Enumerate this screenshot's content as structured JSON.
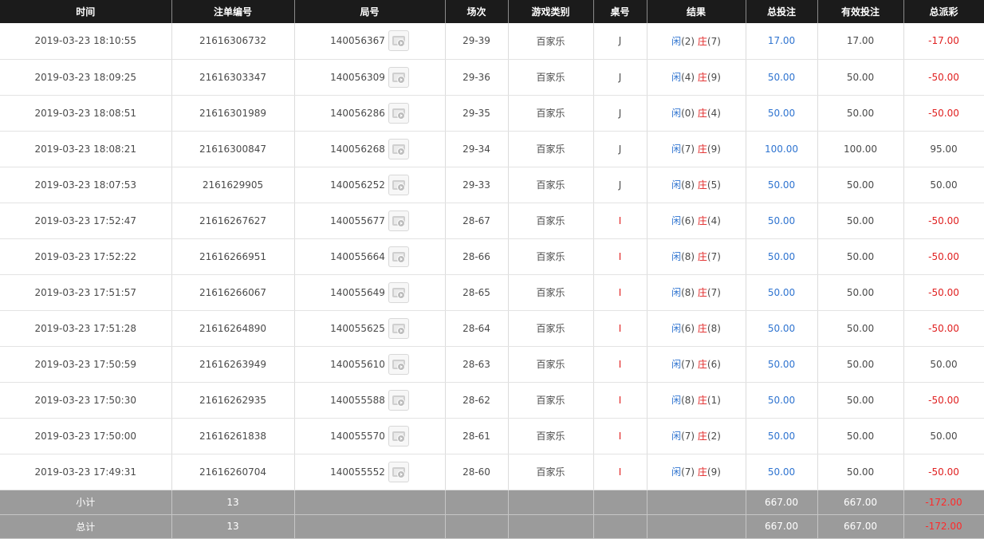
{
  "headers": [
    "时间",
    "注单编号",
    "局号",
    "场次",
    "游戏类别",
    "桌号",
    "结果",
    "总投注",
    "有效投注",
    "总派彩"
  ],
  "result_labels": {
    "player": "闲",
    "banker": "庄"
  },
  "rows": [
    {
      "time": "2019-03-23 18:10:55",
      "bet_id": "21616306732",
      "round": "140056367",
      "session": "29-39",
      "game": "百家乐",
      "table": "J",
      "p": "(2)",
      "b": "(7)",
      "total": "17.00",
      "valid": "17.00",
      "payout": "-17.00",
      "neg": true
    },
    {
      "time": "2019-03-23 18:09:25",
      "bet_id": "21616303347",
      "round": "140056309",
      "session": "29-36",
      "game": "百家乐",
      "table": "J",
      "p": "(4)",
      "b": "(9)",
      "total": "50.00",
      "valid": "50.00",
      "payout": "-50.00",
      "neg": true
    },
    {
      "time": "2019-03-23 18:08:51",
      "bet_id": "21616301989",
      "round": "140056286",
      "session": "29-35",
      "game": "百家乐",
      "table": "J",
      "p": "(0)",
      "b": "(4)",
      "total": "50.00",
      "valid": "50.00",
      "payout": "-50.00",
      "neg": true
    },
    {
      "time": "2019-03-23 18:08:21",
      "bet_id": "21616300847",
      "round": "140056268",
      "session": "29-34",
      "game": "百家乐",
      "table": "J",
      "p": "(7)",
      "b": "(9)",
      "total": "100.00",
      "valid": "100.00",
      "payout": "95.00",
      "neg": false
    },
    {
      "time": "2019-03-23 18:07:53",
      "bet_id": "2161629905",
      "round": "140056252",
      "session": "29-33",
      "game": "百家乐",
      "table": "J",
      "p": "(8)",
      "b": "(5)",
      "total": "50.00",
      "valid": "50.00",
      "payout": "50.00",
      "neg": false
    },
    {
      "time": "2019-03-23 17:52:47",
      "bet_id": "21616267627",
      "round": "140055677",
      "session": "28-67",
      "game": "百家乐",
      "table": "I",
      "p": "(6)",
      "b": "(4)",
      "total": "50.00",
      "valid": "50.00",
      "payout": "-50.00",
      "neg": true
    },
    {
      "time": "2019-03-23 17:52:22",
      "bet_id": "21616266951",
      "round": "140055664",
      "session": "28-66",
      "game": "百家乐",
      "table": "I",
      "p": "(8)",
      "b": "(7)",
      "total": "50.00",
      "valid": "50.00",
      "payout": "-50.00",
      "neg": true
    },
    {
      "time": "2019-03-23 17:51:57",
      "bet_id": "21616266067",
      "round": "140055649",
      "session": "28-65",
      "game": "百家乐",
      "table": "I",
      "p": "(8)",
      "b": "(7)",
      "total": "50.00",
      "valid": "50.00",
      "payout": "-50.00",
      "neg": true
    },
    {
      "time": "2019-03-23 17:51:28",
      "bet_id": "21616264890",
      "round": "140055625",
      "session": "28-64",
      "game": "百家乐",
      "table": "I",
      "p": "(6)",
      "b": "(8)",
      "total": "50.00",
      "valid": "50.00",
      "payout": "-50.00",
      "neg": true
    },
    {
      "time": "2019-03-23 17:50:59",
      "bet_id": "21616263949",
      "round": "140055610",
      "session": "28-63",
      "game": "百家乐",
      "table": "I",
      "p": "(7)",
      "b": "(6)",
      "total": "50.00",
      "valid": "50.00",
      "payout": "50.00",
      "neg": false
    },
    {
      "time": "2019-03-23 17:50:30",
      "bet_id": "21616262935",
      "round": "140055588",
      "session": "28-62",
      "game": "百家乐",
      "table": "I",
      "p": "(8)",
      "b": "(1)",
      "total": "50.00",
      "valid": "50.00",
      "payout": "-50.00",
      "neg": true
    },
    {
      "time": "2019-03-23 17:50:00",
      "bet_id": "21616261838",
      "round": "140055570",
      "session": "28-61",
      "game": "百家乐",
      "table": "I",
      "p": "(7)",
      "b": "(2)",
      "total": "50.00",
      "valid": "50.00",
      "payout": "50.00",
      "neg": false
    },
    {
      "time": "2019-03-23 17:49:31",
      "bet_id": "21616260704",
      "round": "140055552",
      "session": "28-60",
      "game": "百家乐",
      "table": "I",
      "p": "(7)",
      "b": "(9)",
      "total": "50.00",
      "valid": "50.00",
      "payout": "-50.00",
      "neg": true
    }
  ],
  "subtotal": {
    "label": "小计",
    "count": "13",
    "total": "667.00",
    "valid": "667.00",
    "payout": "-172.00"
  },
  "grandtotal": {
    "label": "总计",
    "count": "13",
    "total": "667.00",
    "valid": "667.00",
    "payout": "-172.00"
  },
  "colors": {
    "header_bg": "#1b1b1b",
    "footer_bg": "#9b9b9b",
    "blue": "#2f74d0",
    "red": "#e02020"
  },
  "icons": {
    "replay": "video-replay-icon"
  }
}
